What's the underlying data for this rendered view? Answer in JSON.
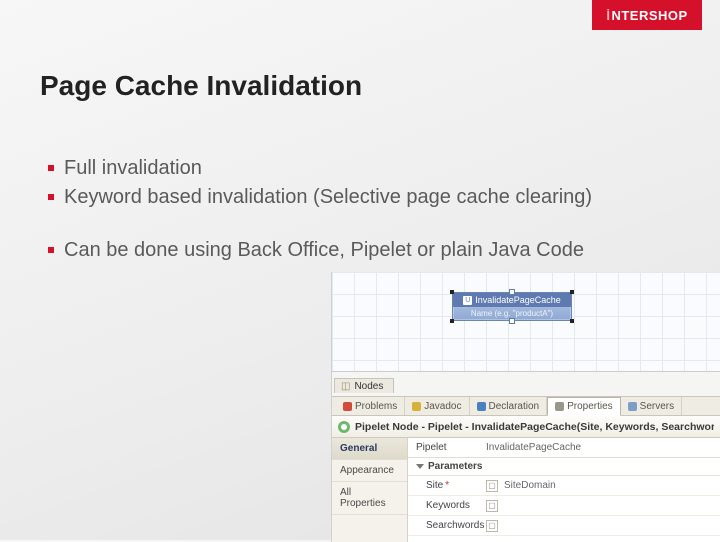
{
  "brand": "NTERSHOP",
  "title": "Page Cache Invalidation",
  "bullets": [
    "Full invalidation",
    "Keyword based invalidation (Selective page cache clearing)",
    "",
    "Can be done using Back Office, Pipelet or plain Java Code"
  ],
  "ide": {
    "node": {
      "title": "InvalidatePageCache",
      "subtitle": "Name (e.g. \"productA\")"
    },
    "palette_tab": "Nodes",
    "view_tabs": [
      {
        "label": "Problems",
        "icon": "ic-red"
      },
      {
        "label": "Javadoc",
        "icon": "ic-yel"
      },
      {
        "label": "Declaration",
        "icon": "ic-blu"
      },
      {
        "label": "Properties",
        "icon": "ic-gry",
        "active": true
      },
      {
        "label": "Servers",
        "icon": "ic-srv"
      }
    ],
    "properties_header": "Pipelet Node - Pipelet - InvalidatePageCache(Site, Keywords, Searchwords):",
    "prop_nav": [
      {
        "label": "General",
        "active": true
      },
      {
        "label": "Appearance"
      },
      {
        "label": "All Properties"
      }
    ],
    "pipelet_row": {
      "label": "Pipelet",
      "value": "InvalidatePageCache"
    },
    "params_section": "Parameters",
    "params": [
      {
        "name": "Site",
        "required": true,
        "value": "SiteDomain"
      },
      {
        "name": "Keywords",
        "required": false,
        "value": ""
      },
      {
        "name": "Searchwords",
        "required": false,
        "value": ""
      }
    ]
  }
}
